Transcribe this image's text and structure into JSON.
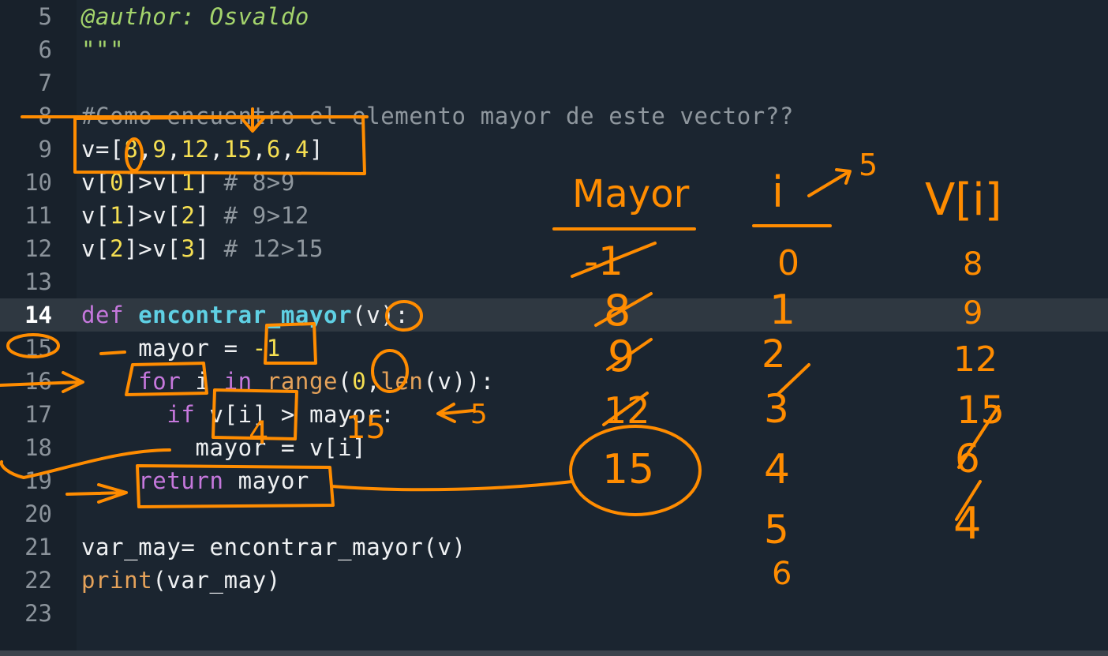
{
  "editor": {
    "current_line": "14",
    "lines": [
      {
        "num": "5",
        "tokens": [
          {
            "t": "@author: Osvaldo",
            "c": "t-doc"
          }
        ]
      },
      {
        "num": "6",
        "tokens": [
          {
            "t": "\"\"\"",
            "c": "t-doc"
          }
        ]
      },
      {
        "num": "7",
        "tokens": []
      },
      {
        "num": "8",
        "tokens": [
          {
            "t": "#Como encuentro el elemento mayor de este vector??",
            "c": "t-cmt"
          }
        ]
      },
      {
        "num": "9",
        "tokens": [
          {
            "t": "v=[",
            "c": "t-txt"
          },
          {
            "t": "8",
            "c": "t-num"
          },
          {
            "t": ",",
            "c": "t-txt"
          },
          {
            "t": "9",
            "c": "t-num"
          },
          {
            "t": ",",
            "c": "t-txt"
          },
          {
            "t": "12",
            "c": "t-num"
          },
          {
            "t": ",",
            "c": "t-txt"
          },
          {
            "t": "15",
            "c": "t-num"
          },
          {
            "t": ",",
            "c": "t-txt"
          },
          {
            "t": "6",
            "c": "t-num"
          },
          {
            "t": ",",
            "c": "t-txt"
          },
          {
            "t": "4",
            "c": "t-num"
          },
          {
            "t": "]",
            "c": "t-txt"
          }
        ]
      },
      {
        "num": "10",
        "tokens": [
          {
            "t": "v[",
            "c": "t-txt"
          },
          {
            "t": "0",
            "c": "t-num"
          },
          {
            "t": "]>v[",
            "c": "t-txt"
          },
          {
            "t": "1",
            "c": "t-num"
          },
          {
            "t": "] ",
            "c": "t-txt"
          },
          {
            "t": "# 8>9",
            "c": "t-cmt"
          }
        ]
      },
      {
        "num": "11",
        "tokens": [
          {
            "t": "v[",
            "c": "t-txt"
          },
          {
            "t": "1",
            "c": "t-num"
          },
          {
            "t": "]>v[",
            "c": "t-txt"
          },
          {
            "t": "2",
            "c": "t-num"
          },
          {
            "t": "] ",
            "c": "t-txt"
          },
          {
            "t": "# 9>12",
            "c": "t-cmt"
          }
        ]
      },
      {
        "num": "12",
        "tokens": [
          {
            "t": "v[",
            "c": "t-txt"
          },
          {
            "t": "2",
            "c": "t-num"
          },
          {
            "t": "]>v[",
            "c": "t-txt"
          },
          {
            "t": "3",
            "c": "t-num"
          },
          {
            "t": "] ",
            "c": "t-txt"
          },
          {
            "t": "# 12>15",
            "c": "t-cmt"
          }
        ]
      },
      {
        "num": "13",
        "tokens": []
      },
      {
        "num": "14",
        "tokens": [
          {
            "t": "def ",
            "c": "t-kw"
          },
          {
            "t": "encontrar_mayor",
            "c": "t-fn"
          },
          {
            "t": "(v):",
            "c": "t-txt"
          }
        ]
      },
      {
        "num": "15",
        "tokens": [
          {
            "t": "    mayor = ",
            "c": "t-txt"
          },
          {
            "t": "-1",
            "c": "t-num"
          }
        ]
      },
      {
        "num": "16",
        "tokens": [
          {
            "t": "    ",
            "c": "t-txt"
          },
          {
            "t": "for",
            "c": "t-kw"
          },
          {
            "t": " i ",
            "c": "t-txt"
          },
          {
            "t": "in",
            "c": "t-kw"
          },
          {
            "t": " ",
            "c": "t-txt"
          },
          {
            "t": "range",
            "c": "t-bi"
          },
          {
            "t": "(",
            "c": "t-txt"
          },
          {
            "t": "0",
            "c": "t-num"
          },
          {
            "t": ",",
            "c": "t-txt"
          },
          {
            "t": "len",
            "c": "t-bi"
          },
          {
            "t": "(v)):",
            "c": "t-txt"
          }
        ]
      },
      {
        "num": "17",
        "tokens": [
          {
            "t": "      ",
            "c": "t-txt"
          },
          {
            "t": "if",
            "c": "t-kw"
          },
          {
            "t": " v[i] > mayor:",
            "c": "t-txt"
          }
        ]
      },
      {
        "num": "18",
        "tokens": [
          {
            "t": "        mayor = v[i]",
            "c": "t-txt"
          }
        ]
      },
      {
        "num": "19",
        "tokens": [
          {
            "t": "    ",
            "c": "t-txt"
          },
          {
            "t": "return",
            "c": "t-kw"
          },
          {
            "t": " mayor",
            "c": "t-txt"
          }
        ]
      },
      {
        "num": "20",
        "tokens": []
      },
      {
        "num": "21",
        "tokens": [
          {
            "t": "var_may= encontrar_mayor(v)",
            "c": "t-txt"
          }
        ]
      },
      {
        "num": "22",
        "tokens": [
          {
            "t": "print",
            "c": "t-bi"
          },
          {
            "t": "(var_may)",
            "c": "t-txt"
          }
        ]
      },
      {
        "num": "23",
        "tokens": []
      }
    ]
  },
  "annotations": {
    "color": "#ff8c00",
    "header_mayor": "Mayor",
    "header_i": "i",
    "header_vi": "V[i]",
    "arrow_five": "5",
    "mayor_values": [
      "-1",
      "8",
      "9",
      "12",
      "15"
    ],
    "mayor_result": "15",
    "i_values": [
      "0",
      "1",
      "2",
      "3",
      "4",
      "5",
      "6"
    ],
    "vi_values": [
      "8",
      "9",
      "12",
      "15",
      "6",
      "4"
    ],
    "scribble_index_zero": "0",
    "scribble_fifteen": "15",
    "scribble_if_five": "5",
    "scribble_vi_four": "4"
  }
}
